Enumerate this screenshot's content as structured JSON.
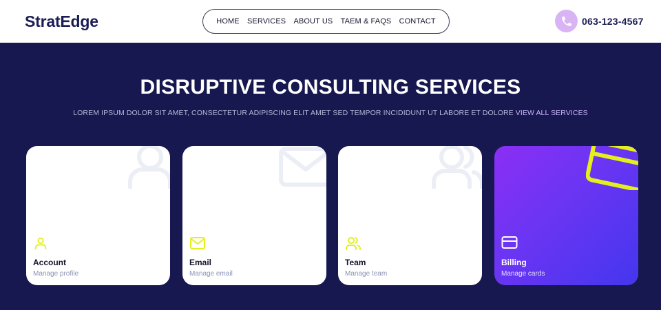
{
  "header": {
    "logo": "StratEdge",
    "nav": [
      "HOME",
      "SERVICES",
      "ABOUT US",
      "TAEM & FAQS",
      "CONTACT"
    ],
    "phone": "063-123-4567",
    "phone_icon": "phone-icon"
  },
  "hero": {
    "title": "DISRUPTIVE CONSULTING SERVICES",
    "subtitle": "LOREM IPSUM DOLOR SIT AMET, CONSECTETUR ADIPISCING ELIT AMET SED TEMPOR INCIDIDUNT UT LABORE ET DOLORE",
    "link": "VIEW ALL SERVICES"
  },
  "cards": [
    {
      "title": "Account",
      "desc": "Manage profile",
      "icon": "user-icon"
    },
    {
      "title": "Email",
      "desc": "Manage email",
      "icon": "mail-icon"
    },
    {
      "title": "Team",
      "desc": "Manage team",
      "icon": "users-icon"
    },
    {
      "title": "Billing",
      "desc": "Manage cards",
      "icon": "credit-card-icon"
    }
  ],
  "colors": {
    "navy": "#17184f",
    "accent_yellow": "#e3f01c",
    "phone_circle": "#d9b4f5",
    "gradient_start": "#8b2ff4",
    "gradient_end": "#4436ee"
  }
}
